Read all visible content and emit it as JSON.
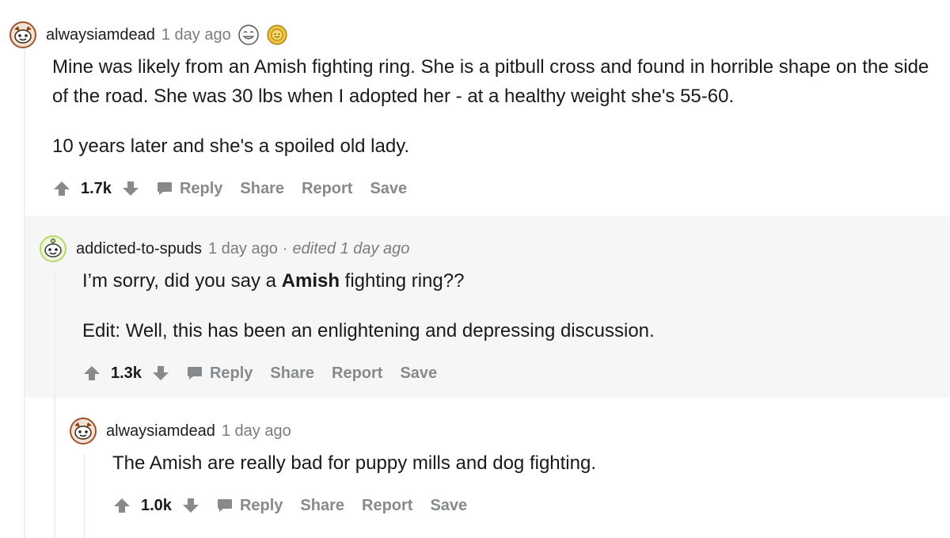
{
  "comments": [
    {
      "author": "alwaysiamdead",
      "time": "1 day ago",
      "body": [
        "Mine was likely from an Amish fighting ring. She is a pitbull cross and found in horrible shape on the side of the road. She was 30 lbs when I adopted her - at a healthy weight she's 55-60.",
        "10 years later and she's a spoiled old lady."
      ],
      "score": "1.7k",
      "actions": [
        "Reply",
        "Share",
        "Report",
        "Save"
      ],
      "avatar_color": "#a0522d"
    },
    {
      "author": "addicted-to-spuds",
      "time": "1 day ago",
      "separator": "·",
      "edited": "edited 1 day ago",
      "body_pre": "I’m sorry, did you say a ",
      "body_bold": "Amish",
      "body_post": " fighting ring??",
      "body_edit": "Edit: Well, this has been an enlightening and depressing discussion.",
      "score": "1.3k",
      "actions": [
        "Reply",
        "Share",
        "Report",
        "Save"
      ],
      "avatar_color": "#b6d86b"
    },
    {
      "author": "alwaysiamdead",
      "time": "1 day ago",
      "body": [
        "The Amish are really bad for puppy mills and dog fighting."
      ],
      "score": "1.0k",
      "actions": [
        "Reply",
        "Share",
        "Report",
        "Save"
      ],
      "avatar_color": "#a0522d"
    }
  ]
}
